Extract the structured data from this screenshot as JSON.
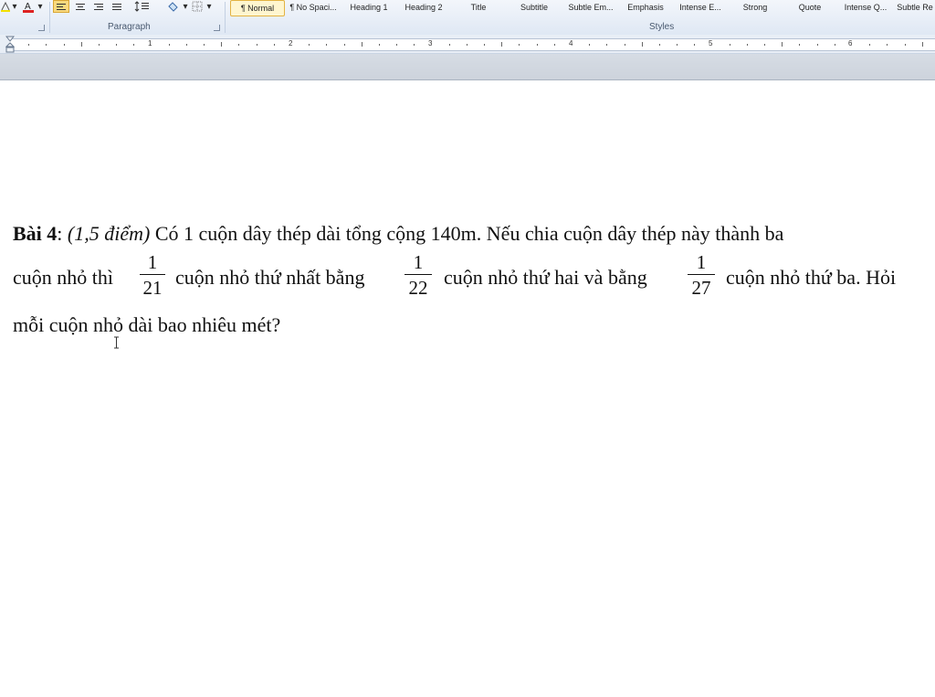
{
  "ribbon": {
    "paragraph_label": "Paragraph",
    "styles_label": "Styles",
    "styles": [
      {
        "label": "¶ Normal"
      },
      {
        "label": "¶ No Spaci..."
      },
      {
        "label": "Heading 1"
      },
      {
        "label": "Heading 2"
      },
      {
        "label": "Title"
      },
      {
        "label": "Subtitle"
      },
      {
        "label": "Subtle Em..."
      },
      {
        "label": "Emphasis"
      },
      {
        "label": "Intense E..."
      },
      {
        "label": "Strong"
      },
      {
        "label": "Quote"
      },
      {
        "label": "Intense Q..."
      },
      {
        "label": "Subtle Re"
      }
    ],
    "active_style": "¶ Normal",
    "accent_color": "#f9d97e"
  },
  "ruler": {
    "numbers": [
      "1",
      "2",
      "3",
      "4",
      "5",
      "6"
    ]
  },
  "document": {
    "line1": {
      "bold": "Bài 4",
      "colon": ":",
      "italic": "(1,5 điểm)",
      "text": " Có 1 cuộn dây thép dài tổng cộng 140m. Nếu chia cuộn dây thép này thành ba"
    },
    "line2": {
      "t1": "cuộn nhỏ thì",
      "frac1_num": "1",
      "frac1_den": "21",
      "t2": "cuộn nhỏ thứ nhất bằng",
      "frac2_num": "1",
      "frac2_den": "22",
      "t3": "cuộn nhỏ thứ hai và bằng",
      "frac3_num": "1",
      "frac3_den": "27",
      "t4": "cuộn nhỏ thứ ba. Hỏi"
    },
    "line3": {
      "text": "mỗi cuộn nhỏ dài bao nhiêu mét?"
    }
  }
}
